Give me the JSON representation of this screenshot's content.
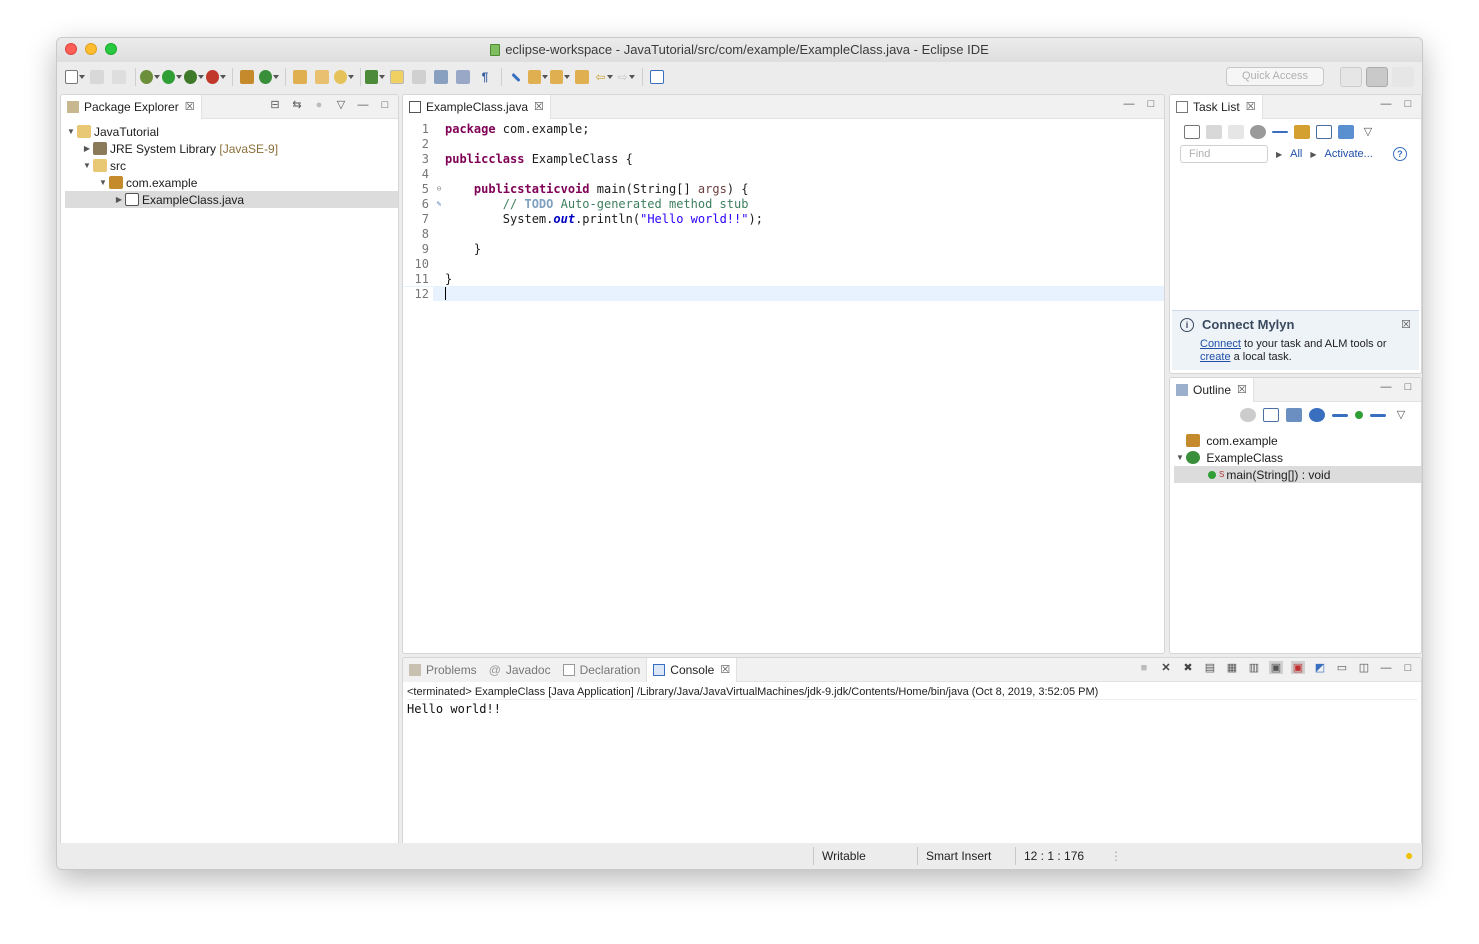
{
  "window": {
    "title": "eclipse-workspace - JavaTutorial/src/com/example/ExampleClass.java - Eclipse IDE"
  },
  "toolbar": {
    "quick_access_placeholder": "Quick Access"
  },
  "package_explorer": {
    "tab_label": "Package Explorer",
    "tree": {
      "project": "JavaTutorial",
      "jre_label": "JRE System Library",
      "jre_version": "[JavaSE-9]",
      "src": "src",
      "package": "com.example",
      "file": "ExampleClass.java"
    }
  },
  "editor": {
    "tab_label": "ExampleClass.java",
    "line_numbers": [
      "1",
      "2",
      "3",
      "4",
      "5",
      "6",
      "7",
      "8",
      "9",
      "10",
      "11",
      "12"
    ],
    "code": {
      "l1_kw": "package",
      "l1_rest": " com.example;",
      "l3_kw1": "public",
      "l3_kw2": "class",
      "l3_rest": " ExampleClass {",
      "l5_kw1": "public",
      "l5_kw2": "static",
      "l5_kw3": "void",
      "l5_rest": " main(String[] ",
      "l5_param": "args",
      "l5_end": ") {",
      "l6_cm1": "// ",
      "l6_todo": "TODO",
      "l6_cm2": " Auto-generated method stub",
      "l7_a": "System.",
      "l7_out": "out",
      "l7_b": ".println(",
      "l7_str": "\"Hello world!!\"",
      "l7_c": ");",
      "l9": "}",
      "l11": "}"
    }
  },
  "task_list": {
    "tab_label": "Task List",
    "find_placeholder": "Find",
    "all_label": "All",
    "activate_label": "Activate...",
    "help_icon": "?"
  },
  "mylyn": {
    "title": "Connect Mylyn",
    "connect_link": "Connect",
    "text1": " to your task and ALM tools or",
    "create_link": "create",
    "text2": " a local task."
  },
  "outline": {
    "tab_label": "Outline",
    "items": {
      "package": "com.example",
      "class": "ExampleClass",
      "method": "main(String[]) : void"
    }
  },
  "bottom": {
    "tabs": {
      "problems": "Problems",
      "javadoc": "Javadoc",
      "declaration": "Declaration",
      "console": "Console"
    },
    "console_terminated": "<terminated> ExampleClass [Java Application] /Library/Java/JavaVirtualMachines/jdk-9.jdk/Contents/Home/bin/java (Oct 8, 2019, 3:52:05 PM)",
    "console_output": "Hello world!!"
  },
  "status": {
    "writable": "Writable",
    "insert_mode": "Smart Insert",
    "position": "12 : 1 : 176"
  }
}
